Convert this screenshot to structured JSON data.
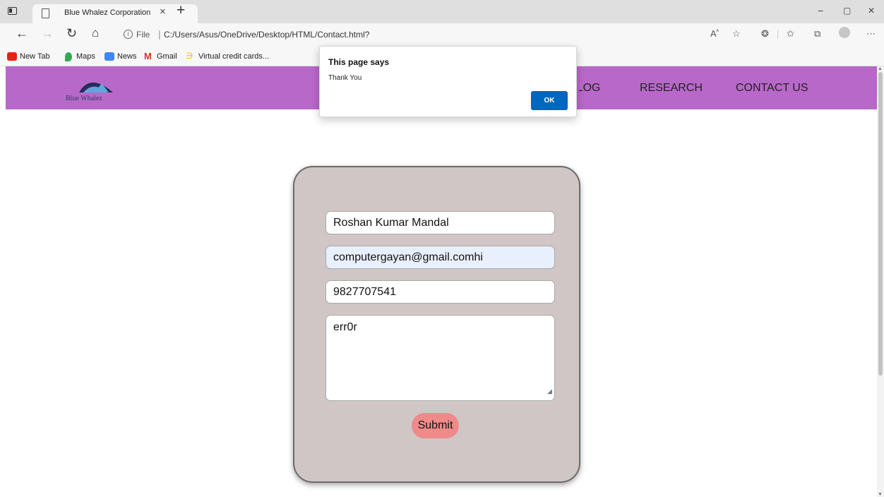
{
  "browser": {
    "tab_title": "Blue Whalez Corporation",
    "close_tab": "×",
    "new_tab": "+",
    "window_controls": {
      "minimize": "−",
      "restore": "▢",
      "close": "✕"
    },
    "nav": {
      "back": "←",
      "forward": "→",
      "refresh": "↻",
      "home": "⌂"
    },
    "address": {
      "prefix": "File",
      "separator": "|",
      "url": "C:/Users/Asus/OneDrive/Desktop/HTML/Contact.html?"
    },
    "toolbar_icons": [
      "read-aloud-icon",
      "favorite-add-icon",
      "extensions-icon",
      "favorites-icon",
      "collections-icon",
      "profile-icon",
      "more-icon"
    ],
    "bookmarks": [
      {
        "label": "New Tab",
        "icon": "youtube-icon",
        "color": "#e62117"
      },
      {
        "label": "Maps",
        "icon": "maps-icon",
        "color": "#34a853"
      },
      {
        "label": "News",
        "icon": "news-icon",
        "color": "#4285f4"
      },
      {
        "label": "Gmail",
        "icon": "gmail-icon",
        "color": "#d93025"
      },
      {
        "label": "Virtual credit cards...",
        "icon": "card-icon",
        "color": "#f4b400"
      }
    ]
  },
  "site": {
    "logo_text": "Blue Whalez",
    "nav": {
      "blog": "BLOG",
      "research": "RESEARCH",
      "contact": "CONTACT US"
    },
    "navbar_color": "#b868c9"
  },
  "form": {
    "name": "Roshan Kumar Mandal",
    "email": "computergayan@gmail.comhi",
    "phone": "9827707541",
    "message": "err0r",
    "submit_label": "Submit",
    "card_color": "#d1c6c6",
    "submit_color": "#f08a8a"
  },
  "dialog": {
    "title": "This page says",
    "message": "Thank You",
    "ok_label": "OK"
  }
}
